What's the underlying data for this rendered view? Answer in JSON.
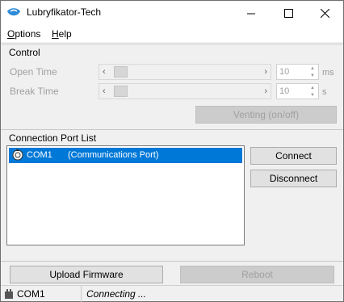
{
  "window": {
    "title": "Lubryfikator-Tech"
  },
  "menu": {
    "options_accel": "O",
    "options_rest": "ptions",
    "help_accel": "H",
    "help_rest": "elp"
  },
  "control": {
    "group_label": "Control",
    "open_time": {
      "label": "Open Time",
      "value": "10",
      "unit": "ms",
      "slider_fraction": 0.0
    },
    "break_time": {
      "label": "Break Time",
      "value": "10",
      "unit": "s",
      "slider_fraction": 0.0
    },
    "venting_button": "Venting (on/off)"
  },
  "connection": {
    "group_label": "Connection Port List",
    "ports": [
      {
        "name": "COM1",
        "description": "(Communications Port)",
        "selected": true
      }
    ],
    "connect_button": "Connect",
    "disconnect_button": "Disconnect"
  },
  "footer": {
    "upload_button": "Upload Firmware",
    "reboot_button": "Reboot"
  },
  "status": {
    "port": "COM1",
    "message": "Connecting ..."
  },
  "colors": {
    "selection": "#0078d7",
    "window_bg": "#f0f0f0",
    "disabled_text": "#a0a0a0"
  }
}
